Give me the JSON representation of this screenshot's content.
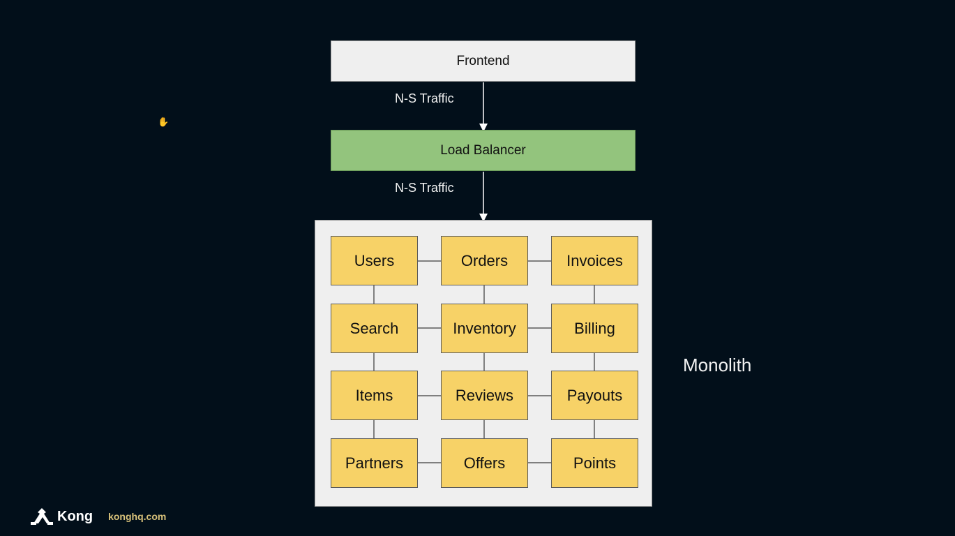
{
  "diagram": {
    "frontend_label": "Frontend",
    "load_balancer_label": "Load Balancer",
    "traffic_label_1": "N-S Traffic",
    "traffic_label_2": "N-S Traffic",
    "monolith_label": "Monolith",
    "services": [
      [
        "Users",
        "Orders",
        "Invoices"
      ],
      [
        "Search",
        "Inventory",
        "Billing"
      ],
      [
        "Items",
        "Reviews",
        "Payouts"
      ],
      [
        "Partners",
        "Offers",
        "Points"
      ]
    ]
  },
  "colors": {
    "background": "#020f1a",
    "frontend": "#efefef",
    "load_balancer": "#93c47d",
    "service": "#f7d267",
    "monolith_container": "#efefef"
  },
  "footer": {
    "brand": "Kong",
    "url": "konghq.com",
    "logo_icon": "kong-gorilla-icon"
  },
  "cursor_icon": "hand-cursor-icon"
}
